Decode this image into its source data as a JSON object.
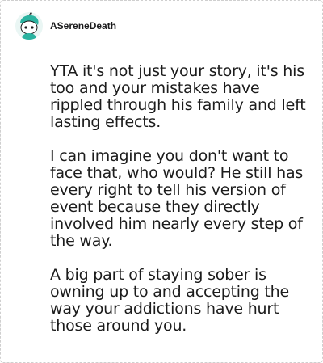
{
  "comment": {
    "username": "ASereneDeath",
    "avatar_icon": "snoo-avatar-icon",
    "paragraphs": [
      "YTA it's not just your story, it's his too and your mistakes have rippled through his family and left lasting effects.",
      "I can imagine you don't want to face that, who would? He still has every right to tell his version of event because they directly involved him nearly every step of the way.",
      "A big part of staying sober is owning up to and accepting the way your addictions have hurt those around you."
    ]
  },
  "colors": {
    "avatar_accent": "#2bb3a0",
    "text": "#1c1c1c",
    "border": "#cfcfcf"
  }
}
